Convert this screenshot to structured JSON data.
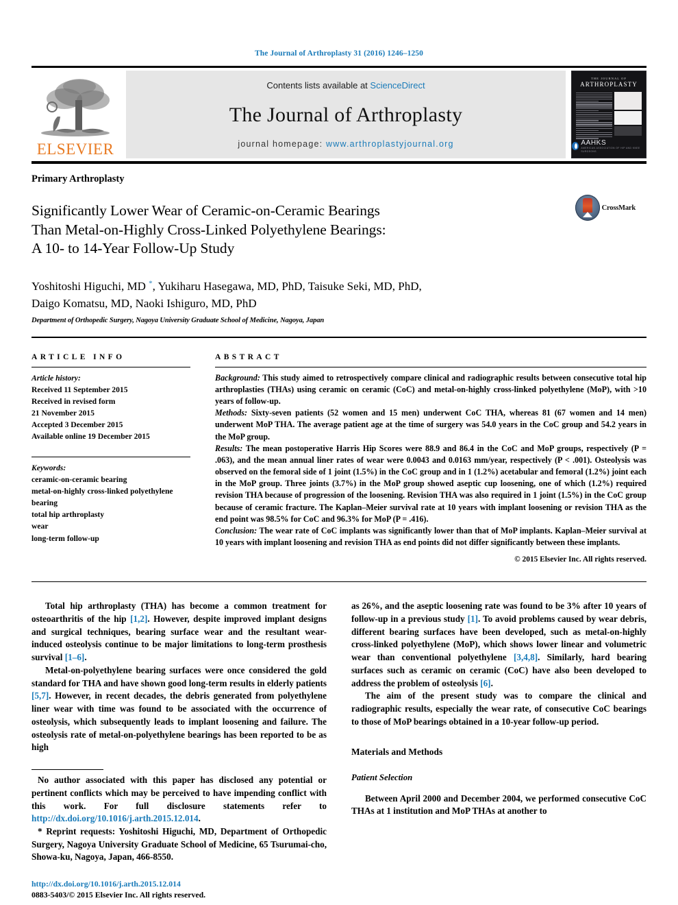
{
  "running_head": "The Journal of Arthroplasty 31 (2016) 1246–1250",
  "masthead": {
    "publisher_logo_label": "ELSEVIER",
    "contents_prefix": "Contents lists available at ",
    "contents_link": "ScienceDirect",
    "journal_title": "The Journal of Arthroplasty",
    "homepage_prefix": "journal homepage: ",
    "homepage_url": "www.arthroplastyjournal.org",
    "cover": {
      "superline": "THE JOURNAL OF",
      "title": "ARTHROPLASTY",
      "society": "AAHKS",
      "society_sub": "AMERICAN ASSOCIATION OF HIP AND KNEE SURGEONS"
    }
  },
  "article": {
    "kicker": "Primary Arthroplasty",
    "title_line1": "Significantly Lower Wear of Ceramic-on-Ceramic Bearings",
    "title_line2": "Than Metal-on-Highly Cross-Linked Polyethylene Bearings:",
    "title_line3": "A 10- to 14-Year Follow-Up Study",
    "crossmark_label": "CrossMark",
    "authors_line1": "Yoshitoshi Higuchi, MD ",
    "authors_line1_rest": ", Yukiharu Hasegawa, MD, PhD, Taisuke Seki, MD, PhD,",
    "authors_line2": "Daigo Komatsu, MD, Naoki Ishiguro, MD, PhD",
    "corresponding_marker": "*",
    "affiliation": "Department of Orthopedic Surgery, Nagoya University Graduate School of Medicine, Nagoya, Japan"
  },
  "article_info": {
    "heading": "ARTICLE INFO",
    "history_label": "Article history:",
    "history": [
      "Received 11 September 2015",
      "Received in revised form",
      "21 November 2015",
      "Accepted 3 December 2015",
      "Available online 19 December 2015"
    ],
    "keywords_label": "Keywords:",
    "keywords": [
      "ceramic-on-ceramic bearing",
      "metal-on-highly cross-linked polyethylene",
      "bearing",
      "total hip arthroplasty",
      "wear",
      "long-term follow-up"
    ]
  },
  "abstract": {
    "heading": "ABSTRACT",
    "background_label": "Background:",
    "background_text": " This study aimed to retrospectively compare clinical and radiographic results between consecutive total hip arthroplasties (THAs) using ceramic on ceramic (CoC) and metal-on-highly cross-linked polyethylene (MoP), with >10 years of follow-up.",
    "methods_label": "Methods:",
    "methods_text": " Sixty-seven patients (52 women and 15 men) underwent CoC THA, whereas 81 (67 women and 14 men) underwent MoP THA. The average patient age at the time of surgery was 54.0 years in the CoC group and 54.2 years in the MoP group.",
    "results_label": "Results:",
    "results_text": " The mean postoperative Harris Hip Scores were 88.9 and 86.4 in the CoC and MoP groups, respectively (P = .063), and the mean annual liner rates of wear were 0.0043 and 0.0163 mm/year, respectively (P < .001). Osteolysis was observed on the femoral side of 1 joint (1.5%) in the CoC group and in 1 (1.2%) acetabular and femoral (1.2%) joint each in the MoP group. Three joints (3.7%) in the MoP group showed aseptic cup loosening, one of which (1.2%) required revision THA because of progression of the loosening. Revision THA was also required in 1 joint (1.5%) in the CoC group because of ceramic fracture. The Kaplan–Meier survival rate at 10 years with implant loosening or revision THA as the end point was 98.5% for CoC and 96.3% for MoP (P = .416).",
    "conclusion_label": "Conclusion:",
    "conclusion_text": " The wear rate of CoC implants was significantly lower than that of MoP implants. Kaplan–Meier survival at 10 years with implant loosening and revision THA as end points did not differ significantly between these implants.",
    "copyright": "© 2015 Elsevier Inc. All rights reserved."
  },
  "body": {
    "left": {
      "para1_a": "Total hip arthroplasty (THA) has become a common treatment for osteoarthritis of the hip ",
      "para1_ref1": "[1,2]",
      "para1_b": ". However, despite improved implant designs and surgical techniques, bearing surface wear and the resultant wear-induced osteolysis continue to be major limitations to long-term prosthesis survival ",
      "para1_ref2": "[1–6]",
      "para1_c": ".",
      "para2_a": "Metal-on-polyethylene bearing surfaces were once considered the gold standard for THA and have shown good long-term results in elderly patients ",
      "para2_ref1": "[5,7]",
      "para2_b": ". However, in recent decades, the debris generated from polyethylene liner wear with time was found to be associated with the occurrence of osteolysis, which subsequently leads to implant loosening and failure. The osteolysis rate of metal-on-polyethylene bearings has been reported to be as high"
    },
    "right": {
      "para1_a": "as 26%, and the aseptic loosening rate was found to be 3% after 10 years of follow-up in a previous study ",
      "para1_ref1": "[1]",
      "para1_b": ". To avoid problems caused by wear debris, different bearing surfaces have been developed, such as metal-on-highly cross-linked polyethylene (MoP), which shows lower linear and volumetric wear than conventional polyethylene ",
      "para1_ref2": "[3,4,8]",
      "para1_c": ". Similarly, hard bearing surfaces such as ceramic on ceramic (CoC) have also been developed to address the problem of osteolysis ",
      "para1_ref3": "[6]",
      "para1_d": ".",
      "para2": "The aim of the present study was to compare the clinical and radiographic results, especially the wear rate, of consecutive CoC bearings to those of MoP bearings obtained in a 10-year follow-up period.",
      "heading_materials": "Materials and Methods",
      "heading_patient": "Patient Selection",
      "para3": "Between April 2000 and December 2004, we performed consecutive CoC THAs at 1 institution and MoP THAs at another to"
    }
  },
  "footnotes": {
    "disclosure_a": "No author associated with this paper has disclosed any potential or pertinent conflicts which may be perceived to have impending conflict with this work. For full disclosure statements refer to ",
    "disclosure_link": "http://dx.doi.org/10.1016/j.arth.2015.12.014",
    "disclosure_b": ".",
    "reprint_marker": "* ",
    "reprint": "Reprint requests: Yoshitoshi Higuchi, MD, Department of Orthopedic Surgery, Nagoya University Graduate School of Medicine, 65 Tsurumai-cho, Showa-ku, Nagoya, Japan, 466-8550.",
    "doi": "http://dx.doi.org/10.1016/j.arth.2015.12.014",
    "issn": "0883-5403/© 2015 Elsevier Inc. All rights reserved."
  },
  "colors": {
    "link": "#1a7bb9",
    "elsevier_orange": "#e87a22"
  }
}
